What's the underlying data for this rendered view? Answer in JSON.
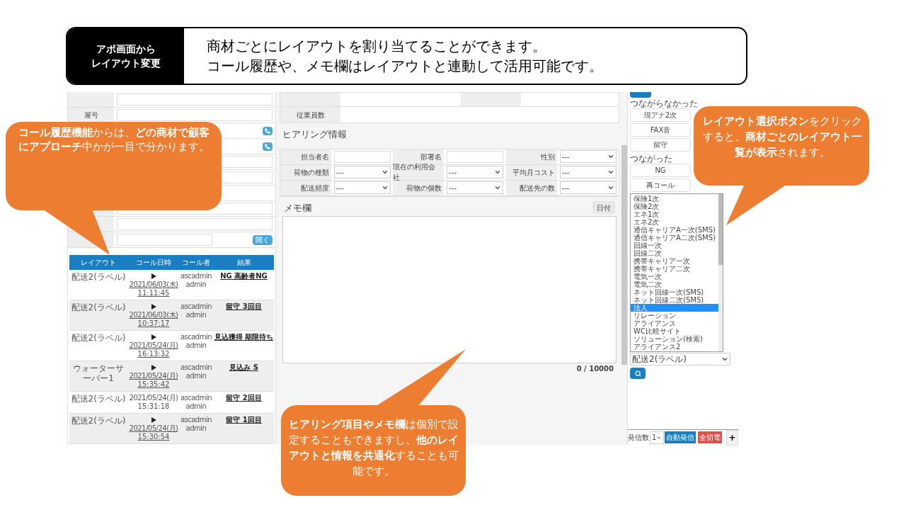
{
  "header": {
    "tag_lines": [
      "アポ画面から",
      "レイアウト変更"
    ],
    "lines": [
      "商材ごとにレイアウトを割り当てることができます。",
      "コール履歴や、メモ欄はレイアウトと連動して活用可能です。"
    ]
  },
  "company_form": {
    "rows": [
      {
        "kind": "input"
      },
      {
        "kind": "input",
        "label": "屋号"
      },
      {
        "kind": "phone"
      },
      {
        "kind": "phone"
      },
      {
        "kind": "input"
      },
      {
        "kind": "input"
      },
      {
        "kind": "blank"
      },
      {
        "kind": "input"
      },
      {
        "kind": "input"
      },
      {
        "kind": "open",
        "button": "開く"
      }
    ]
  },
  "call_history": {
    "columns": [
      "レイアウト",
      "コール日時",
      "コール者",
      "結果"
    ],
    "rows": [
      {
        "layout": "配送2(ラベル)",
        "has_recording": true,
        "date": "2021/06/03(木)",
        "time": "11:11:45",
        "caller": [
          "ascadmin",
          "admin"
        ],
        "result": "NG 高齢者NG"
      },
      {
        "layout": "配送2(ラベル)",
        "has_recording": true,
        "date": "2021/06/03(木)",
        "time": "10:37:17",
        "caller": [
          "ascadmin",
          "admin"
        ],
        "result": "留守 3回目"
      },
      {
        "layout": "配送2(ラベル)",
        "has_recording": true,
        "date": "2021/05/24(月)",
        "time": "16:13:32",
        "caller": [
          "ascadmin",
          "admin"
        ],
        "result": "見込獲得 期限待ち"
      },
      {
        "layout": "ウォーターサーバー1",
        "has_recording": true,
        "date": "2021/05/24(月)",
        "time": "15:35:42",
        "caller": [
          "ascadmin",
          "admin"
        ],
        "result": "見込み S"
      },
      {
        "layout": "配送2(ラベル)",
        "has_recording": false,
        "date": "2021/05/24(月)",
        "time": "15:31:18",
        "caller": [
          "ascadmin",
          "admin"
        ],
        "result": "留守 2回目"
      },
      {
        "layout": "配送2(ラベル)",
        "has_recording": true,
        "date": "2021/05/24(月)",
        "time": "15:30:54",
        "caller": [
          "ascadmin",
          "admin"
        ],
        "result": "留守 1回目"
      }
    ]
  },
  "company_table": {
    "employees_label": "従業員数"
  },
  "hearing": {
    "title": "ヒアリング情報",
    "fields": [
      {
        "label": "担当者名",
        "kind": "text"
      },
      {
        "label": "部署名",
        "kind": "text"
      },
      {
        "label": "性別",
        "kind": "select",
        "value": "---"
      },
      {
        "label": "荷物の種類",
        "kind": "select",
        "value": "---"
      },
      {
        "label": "現在の利用会社",
        "kind": "select",
        "value": "---"
      },
      {
        "label": "平均月コスト",
        "kind": "select",
        "value": "---"
      },
      {
        "label": "配送頻度",
        "kind": "select",
        "value": "---"
      },
      {
        "label": "荷物の個数",
        "kind": "select",
        "value": "---"
      },
      {
        "label": "配送先の数",
        "kind": "select",
        "value": "---"
      }
    ]
  },
  "memo": {
    "title": "メモ欄",
    "date_button": "日付",
    "counter": "0 / 10000"
  },
  "dialer": {
    "groups": [
      {
        "label": "つながらなかった",
        "buttons": [
          "現アナ2次",
          "FAX音",
          "留守"
        ]
      },
      {
        "label": "つながった",
        "buttons": [
          "NG",
          "再コール"
        ]
      }
    ],
    "layout_options": [
      {
        "label": "保険1次",
        "selected": false
      },
      {
        "label": "保険2次",
        "selected": false
      },
      {
        "label": "エネ1次",
        "selected": false
      },
      {
        "label": "エネ2次",
        "selected": false
      },
      {
        "label": "通信キャリアA一次(SMS)",
        "selected": false
      },
      {
        "label": "通信キャリアA二次(SMS)",
        "selected": false
      },
      {
        "label": "回線一次",
        "selected": false
      },
      {
        "label": "回線二次",
        "selected": false
      },
      {
        "label": "携帯キャリア一次",
        "selected": false
      },
      {
        "label": "携帯キャリア二次",
        "selected": false
      },
      {
        "label": "電気一次",
        "selected": false
      },
      {
        "label": "電気二次",
        "selected": false
      },
      {
        "label": "ネット回線一次(SMS)",
        "selected": false
      },
      {
        "label": "ネット回線二次(SMS)",
        "selected": false
      },
      {
        "label": "法人",
        "selected": true
      },
      {
        "label": "リレーション",
        "selected": false
      },
      {
        "label": "アライアンス",
        "selected": false
      },
      {
        "label": "WC比較サイト",
        "selected": false
      },
      {
        "label": "ソリューション(検索)",
        "selected": false
      },
      {
        "label": "アライアンス2",
        "selected": false
      }
    ],
    "layout_select": "配送2(ラベル)",
    "count_label": "発信数",
    "count_value": "1",
    "auto_button": "自動発信",
    "hangup_button": "全切電",
    "add_button": "+"
  },
  "callouts": [
    {
      "text": "**コール履歴機能**からは、**どの商材で顧客にアプローチ**中かが一目で分かります。"
    },
    {
      "text": "**レイアウト選択ボタン**をクリックすると、**商材ごとのレイアウト一覧が表示**されます。"
    },
    {
      "text": "**ヒアリング項目やメモ欄**は個別で設定することもできますし、**他のレイアウトと情報を共通化**することも可能です。"
    }
  ]
}
